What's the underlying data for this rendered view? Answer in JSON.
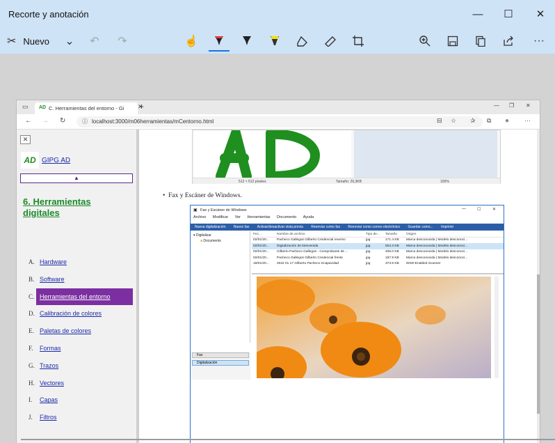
{
  "app": {
    "title": "Recorte y anotación",
    "new_label": "Nuevo",
    "accent_color": "#1a73e8"
  },
  "toolbar": {
    "icons": [
      "touch-writing-icon",
      "ballpoint-pen-icon",
      "pencil-icon",
      "highlighter-icon",
      "eraser-icon",
      "ruler-icon",
      "crop-icon",
      "zoom-icon",
      "save-icon",
      "copy-icon",
      "share-icon",
      "more-icon"
    ]
  },
  "browser": {
    "tab_title": "C. Herramientas del entorno - Gi",
    "tab_favicon": "AD",
    "url": "localhost:3000/m06herramientas/mCentorno.html"
  },
  "sidebar": {
    "logo": "AD",
    "brand": "GIPG AD",
    "collapse_symbol": "▲",
    "section_title": "6. Herramientas digitales",
    "items": [
      {
        "letter": "A.",
        "label": "Hardware"
      },
      {
        "letter": "B.",
        "label": "Software"
      },
      {
        "letter": "C.",
        "label": "Herramientas del entorno"
      },
      {
        "letter": "D.",
        "label": "Calibración de colores"
      },
      {
        "letter": "E.",
        "label": "Paletas de colores"
      },
      {
        "letter": "F.",
        "label": "Formas"
      },
      {
        "letter": "G.",
        "label": "Trazos"
      },
      {
        "letter": "H.",
        "label": "Vectores"
      },
      {
        "letter": "I.",
        "label": "Capas"
      },
      {
        "letter": "J.",
        "label": "Filtros"
      }
    ],
    "active_index": 2,
    "active_color": "#7b2fa0"
  },
  "content": {
    "paint_status": {
      "size": "512 × 512 píxeles",
      "file_size": "Tamaño: 26,3KB",
      "zoom": "100%"
    },
    "bullet": "Fax y Escáner de Windows.",
    "fax": {
      "title": "Fax y Escáner de Windows",
      "menu": [
        "Archivo",
        "Modificar",
        "Ver",
        "Herramientas",
        "Documento",
        "Ayuda"
      ],
      "toolbar": [
        "Nueva digitalización",
        "Nuevo fax",
        "Activar/desactivar vista previa",
        "Reenviar como fax",
        "Reenviar como correo electrónico",
        "Guardar como...",
        "Imprimir"
      ],
      "tree": [
        "Digitalizar",
        "Documents"
      ],
      "columns": [
        "Fec...",
        "Nombre de archivo",
        "Tipo de...",
        "Tamaño",
        "Origen"
      ],
      "rows": [
        [
          "02/01/20...",
          "Pacheco Gallegos Gilberto Credencial reverso",
          "jpg",
          "171.4 KB",
          "Marca desconocida | Modelo desconoci..."
        ],
        [
          "02/01/20...",
          "Digitalización de bienvenida",
          "jpg",
          "504.3 KB",
          "Marca desconocida | Modelo desconoci..."
        ],
        [
          "02/01/20...",
          "Gilberto Pacheco Gallegos - Comprobante de ...",
          "jpg",
          "406.0 KB",
          "Marca desconocida | Modelo desconoci..."
        ],
        [
          "02/01/20...",
          "Pacheco Gallegos Gilberto Credencial frente",
          "jpg",
          "187.9 KB",
          "Marca desconocida | Modelo desconoci..."
        ],
        [
          "18/01/20...",
          "2022 01 17 Gilberto Pacheco incapacidad",
          "jpg",
          "373.5 KB",
          "WSD-Enabled Scanner"
        ]
      ],
      "selected_row": 1,
      "bottom": [
        "Fax",
        "Digitalización"
      ]
    }
  }
}
